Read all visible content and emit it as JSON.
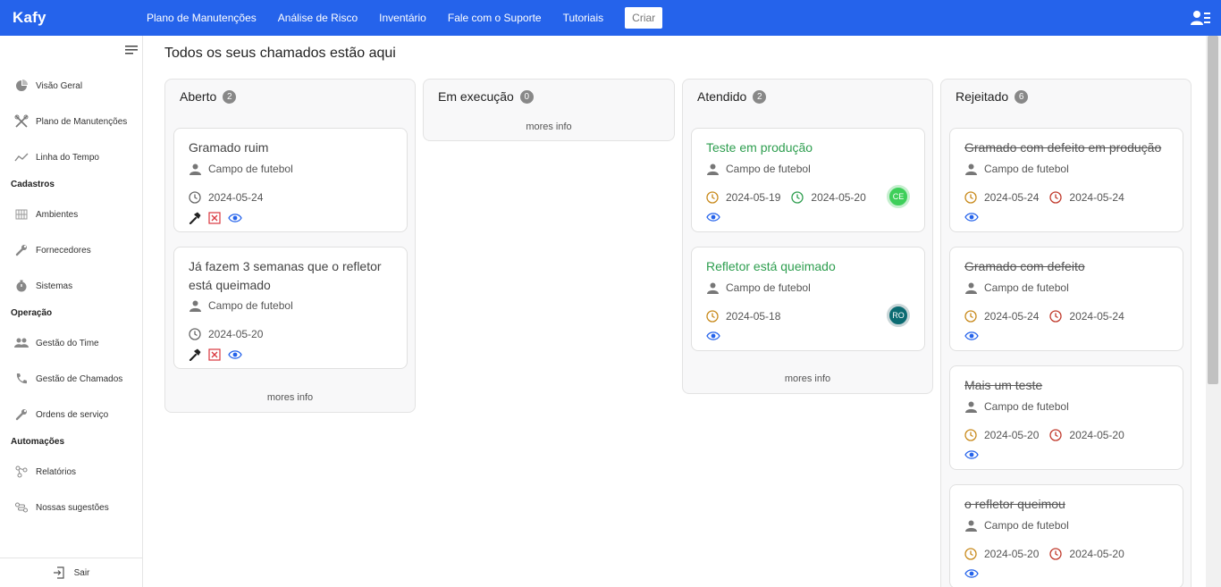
{
  "topbar": {
    "brand": "Kafy",
    "nav": [
      "Plano de Manutenções",
      "Análise de Risco",
      "Inventário",
      "Fale com o Suporte",
      "Tutoriais"
    ],
    "criar_label": "Criar",
    "color": "#2563eb"
  },
  "sidebar": {
    "items": [
      {
        "label": "Visão Geral",
        "icon": "pie-chart-icon"
      },
      {
        "label": "Plano de Manutenções",
        "icon": "tools-icon"
      },
      {
        "label": "Linha do Tempo",
        "icon": "trend-line-icon"
      },
      {
        "label": "Ambientes",
        "icon": "building-icon"
      },
      {
        "label": "Fornecedores",
        "icon": "wrench-icon"
      },
      {
        "label": "Sistemas",
        "icon": "stopwatch-icon"
      },
      {
        "label": "Gestão do Time",
        "icon": "users-icon"
      },
      {
        "label": "Gestão de Chamados",
        "icon": "phone-icon"
      },
      {
        "label": "Ordens de serviço",
        "icon": "wrench-icon"
      },
      {
        "label": "Relatórios",
        "icon": "nodes-icon"
      },
      {
        "label": "Nossas sugestões",
        "icon": "route-icon"
      }
    ],
    "sections": [
      "Cadastros",
      "Operação",
      "Automações"
    ],
    "logout_label": "Sair"
  },
  "main": {
    "title": "Todos os seus chamados estão aqui",
    "more_info": "mores info",
    "columns": [
      {
        "title": "Aberto",
        "count": "2",
        "cards": [
          {
            "title": "Gramado ruim",
            "location": "Campo de futebol",
            "date": "2024-05-24"
          },
          {
            "title": "Já fazem 3 semanas que o refletor está queimado",
            "location": "Campo de futebol",
            "date": "2024-05-20"
          }
        ]
      },
      {
        "title": "Em execução",
        "count": "0",
        "cards": []
      },
      {
        "title": "Atendido",
        "count": "2",
        "cards": [
          {
            "title": "Teste em produção",
            "location": "Campo de futebol",
            "date_open": "2024-05-19",
            "date_done": "2024-05-20",
            "avatar": "CE",
            "avatar_color": "#3ecf5a"
          },
          {
            "title": "Refletor está queimado",
            "location": "Campo de futebol",
            "date_open": "2024-05-18",
            "avatar": "RO",
            "avatar_color": "#0b6b72"
          }
        ]
      },
      {
        "title": "Rejeitado",
        "count": "6",
        "cards": [
          {
            "title": "Gramado com defeito em produção",
            "location": "Campo de futebol",
            "date_open": "2024-05-24",
            "date_rejected": "2024-05-24"
          },
          {
            "title": "Gramado com defeito",
            "location": "Campo de futebol",
            "date_open": "2024-05-24",
            "date_rejected": "2024-05-24"
          },
          {
            "title": "Mais um teste",
            "location": "Campo de futebol",
            "date_open": "2024-05-20",
            "date_rejected": "2024-05-20"
          },
          {
            "title": "o refletor queimou",
            "location": "Campo de futebol",
            "date_open": "2024-05-20",
            "date_rejected": "2024-05-20"
          }
        ]
      }
    ]
  },
  "colors": {
    "green_title": "#2e9e4f",
    "clock_open": "#c8891a",
    "clock_done": "#2e9e4f",
    "clock_rejected": "#c0392b",
    "view_icon": "#2563eb"
  }
}
